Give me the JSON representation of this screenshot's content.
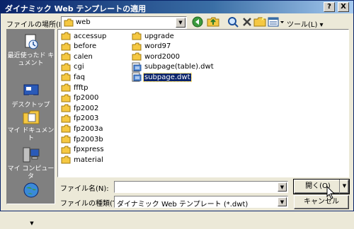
{
  "window": {
    "title": "ダイナミック Web テンプレートの適用",
    "help_label": "?",
    "close_label": "X"
  },
  "lookin": {
    "label": "ファイルの場所(I):",
    "value": "web"
  },
  "toolbar": {
    "tools_label": "ツール(L) ▾"
  },
  "places": [
    {
      "label": "最近使ったド キュメント",
      "icon": "recent-docs-icon"
    },
    {
      "label": "デスクトップ",
      "icon": "desktop-icon"
    },
    {
      "label": "マイ ドキュメント",
      "icon": "my-documents-icon"
    },
    {
      "label": "マイ コンピュータ",
      "icon": "my-computer-icon"
    }
  ],
  "files": {
    "col1": [
      "accessup",
      "before",
      "calen",
      "cgi",
      "faq",
      "ffftp",
      "fp2000",
      "fp2002",
      "fp2003",
      "fp2003a",
      "fp2003b",
      "fpxpress",
      "material"
    ],
    "col2": [
      {
        "name": "upgrade",
        "type": "folder"
      },
      {
        "name": "word97",
        "type": "folder"
      },
      {
        "name": "word2000",
        "type": "folder"
      },
      {
        "name": "subpage(table).dwt",
        "type": "dwt"
      },
      {
        "name": "subpage.dwt",
        "type": "dwt",
        "selected": true
      }
    ]
  },
  "filename": {
    "label": "ファイル名(N):",
    "value": ""
  },
  "filetype": {
    "label": "ファイルの種類(T):",
    "value": "ダイナミック Web テンプレート (*.dwt)"
  },
  "buttons": {
    "open_label": "開く(O)",
    "cancel_label": "キャンセル"
  },
  "colors": {
    "title_bar": "#0a246a",
    "folder": "#f5c842",
    "selection": "#0a246a"
  }
}
